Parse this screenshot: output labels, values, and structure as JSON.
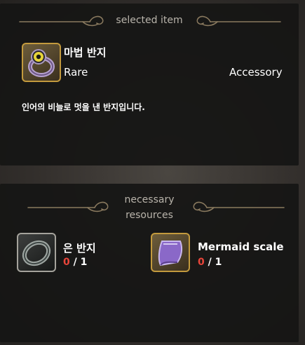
{
  "selected": {
    "section_title": "selected item",
    "item_name": "마법 반지",
    "rarity": "Rare",
    "category": "Accessory",
    "description": "인어의 비늘로 멋을 낸 반지입니다.",
    "icon": "magic-ring-icon"
  },
  "resources": {
    "section_title": "necessary resources",
    "items": [
      {
        "name": "은 반지",
        "have": "0",
        "separator": "/",
        "need": "1",
        "icon": "silver-ring-icon"
      },
      {
        "name": "Mermaid scale",
        "have": "0",
        "separator": "/",
        "need": "1",
        "icon": "mermaid-scale-icon"
      }
    ]
  },
  "colors": {
    "gold_frame": "#c39a3d",
    "silver_frame": "#a5a39c",
    "missing_count": "#e8453a",
    "ornament": "#8a7a5f"
  }
}
